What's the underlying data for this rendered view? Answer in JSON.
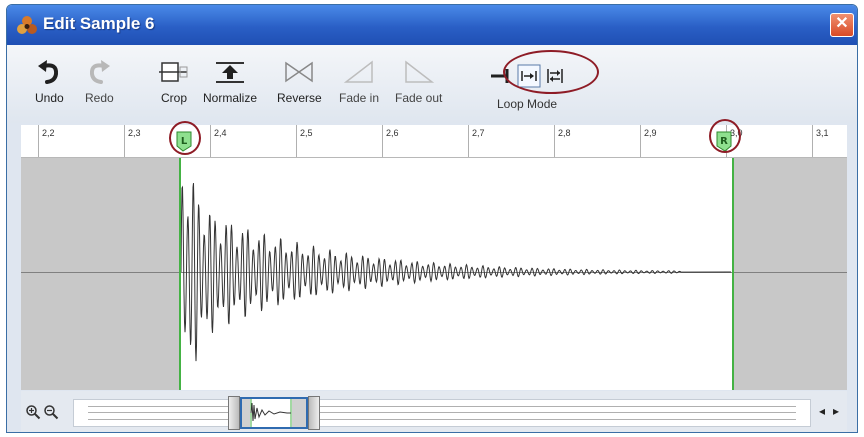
{
  "window": {
    "title": "Edit Sample 6",
    "close_glyph": "✕"
  },
  "toolbar": {
    "undo": "Undo",
    "redo": "Redo",
    "crop": "Crop",
    "normalize": "Normalize",
    "reverse": "Reverse",
    "fade_in": "Fade in",
    "fade_out": "Fade out",
    "loop_mode": "Loop Mode"
  },
  "ruler": {
    "ticks": [
      "2,2",
      "2,3",
      "2,4",
      "2,5",
      "2,6",
      "2,7",
      "2,8",
      "2,9",
      "3,0",
      "3,1"
    ]
  },
  "markers": {
    "loop_start": "L",
    "loop_end": "R"
  },
  "navigator": {
    "prev": "◂",
    "next": "▸"
  },
  "colors": {
    "titlebar": "#2a5fc6",
    "marker_line": "#44b244",
    "annotation": "#8e1c26"
  }
}
